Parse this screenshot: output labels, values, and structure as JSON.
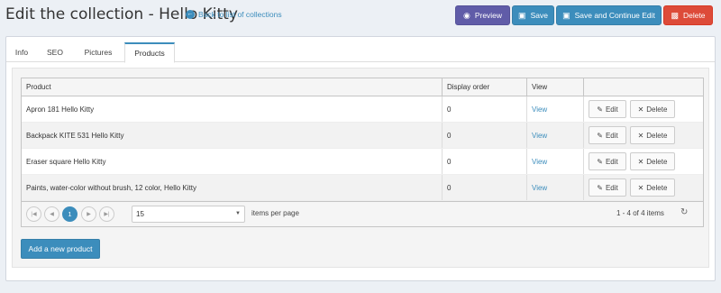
{
  "header": {
    "title": "Edit the collection - Hello Kitty",
    "back_link": "Back to list of collections",
    "buttons": {
      "preview": "Preview",
      "save": "Save",
      "save_continue": "Save and Continue Edit",
      "delete": "Delete"
    }
  },
  "tabs": [
    {
      "label": "Info",
      "active": false
    },
    {
      "label": "SEO",
      "active": false
    },
    {
      "label": "Pictures",
      "active": false
    },
    {
      "label": "Products",
      "active": true
    }
  ],
  "grid": {
    "columns": [
      "Product",
      "Display order",
      "View",
      ""
    ],
    "rows": [
      {
        "product": "Apron 181 Hello Kitty",
        "order": "0",
        "view": "View",
        "edit": "Edit",
        "delete": "Delete"
      },
      {
        "product": "Backpack KITE 531 Hello Kitty",
        "order": "0",
        "view": "View",
        "edit": "Edit",
        "delete": "Delete"
      },
      {
        "product": "Eraser square Hello Kitty",
        "order": "0",
        "view": "View",
        "edit": "Edit",
        "delete": "Delete"
      },
      {
        "product": "Paints, water-color without brush, 12 color, Hello Kitty",
        "order": "0",
        "view": "View",
        "edit": "Edit",
        "delete": "Delete"
      }
    ],
    "pager": {
      "current_page": "1",
      "page_size": "15",
      "items_per_page": "items per page",
      "range": "1 - 4 of 4 items"
    }
  },
  "add_button": "Add a new product",
  "colors": {
    "primary": "#3c8dbc",
    "preview": "#605ca8",
    "danger": "#dd4b39"
  }
}
